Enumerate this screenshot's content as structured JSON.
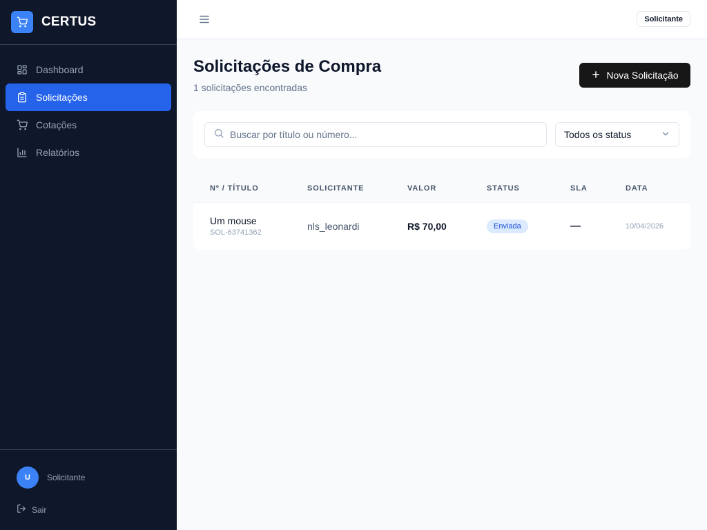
{
  "app": {
    "name": "CERTUS"
  },
  "sidebar": {
    "items": [
      {
        "label": "Dashboard",
        "icon": "dashboard-icon",
        "active": false
      },
      {
        "label": "Solicitações",
        "icon": "clipboard-icon",
        "active": true
      },
      {
        "label": "Cotações",
        "icon": "cart-icon",
        "active": false
      },
      {
        "label": "Relatórios",
        "icon": "bar-chart-icon",
        "active": false
      }
    ],
    "user": {
      "avatar_initial": "U",
      "name": "Solicitante"
    },
    "logout_label": "Sair"
  },
  "header": {
    "role": "Solicitante",
    "menu_icon": "menu-icon"
  },
  "page": {
    "title": "Solicitações de Compra",
    "subtitle": "1 solicitações encontradas",
    "new_button_label": "Nova Solicitação"
  },
  "filters": {
    "search_placeholder": "Buscar por título ou número...",
    "search_value": "",
    "status_selected": "Todos os status"
  },
  "table": {
    "columns": [
      "Nº / TÍTULO",
      "SOLICITANTE",
      "VALOR",
      "STATUS",
      "SLA",
      "DATA"
    ],
    "rows": [
      {
        "title": "Um mouse",
        "number": "SOL-63741362",
        "requester": "nls_leonardi",
        "value": "R$ 70,00",
        "status": "Enviada",
        "sla": "—",
        "date": "10/04/2026"
      }
    ]
  },
  "colors": {
    "sidebar_bg": "#0f172a",
    "accent": "#2563eb",
    "brand_logo": "#3b82f6",
    "primary_button": "#171717",
    "status_badge_bg": "#dbeafe",
    "status_badge_text": "#1d4ed8"
  }
}
